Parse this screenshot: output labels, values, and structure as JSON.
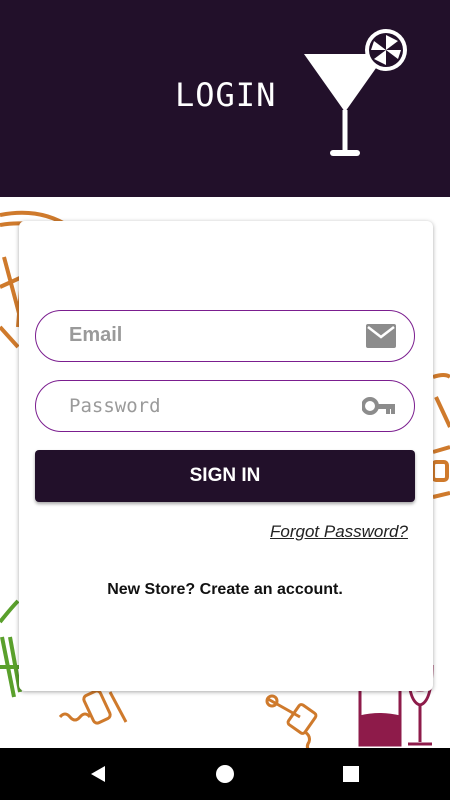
{
  "header": {
    "title": "LOGIN"
  },
  "form": {
    "email_placeholder": "Email",
    "password_placeholder": "Password",
    "signin_label": "SIGN IN",
    "forgot_label": "Forgot Password?",
    "create_account_label": "New Store? Create an account."
  },
  "icons": {
    "email": "envelope-icon",
    "password": "key-icon",
    "header": "cocktail-glass-icon"
  },
  "colors": {
    "header_bg": "#22102a",
    "field_border": "#7b1e8f",
    "button_bg": "#22102a",
    "decor_orange": "#cf7a2c",
    "decor_wine": "#8e1b4a",
    "decor_green": "#5aa02c"
  },
  "navbar": {
    "buttons": [
      "back-icon",
      "home-icon",
      "recents-icon"
    ]
  }
}
